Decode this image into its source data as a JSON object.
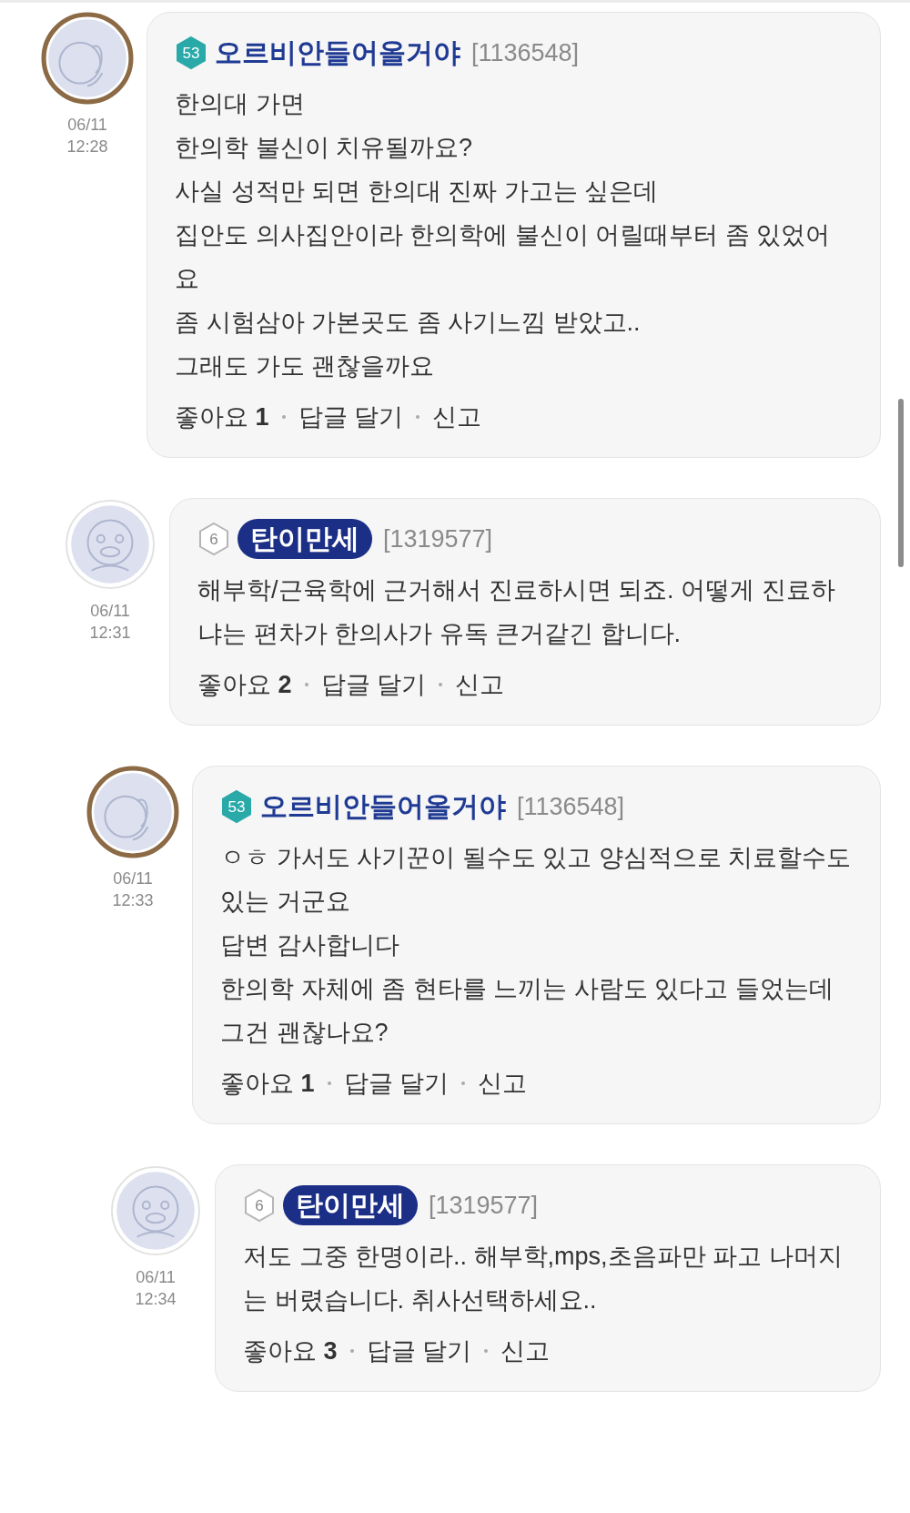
{
  "comments": [
    {
      "user": {
        "kind": "ring",
        "level": "53",
        "name": "오르비안들어올거야",
        "id": "[1136548]"
      },
      "date": "06/11",
      "time": "12:28",
      "lines": [
        "한의대 가면",
        "한의학 불신이 치유될까요?",
        "사실 성적만 되면 한의대 진짜 가고는 싶은데",
        "집안도 의사집안이라 한의학에 불신이 어릴때부터 좀 있었어요",
        "좀 시험삼아 가본곳도 좀 사기느낌 받았고..",
        "그래도 가도 괜찮을까요"
      ],
      "like_label": "좋아요",
      "likes": "1",
      "reply_label": "답글 달기",
      "report_label": "신고",
      "children": [
        {
          "user": {
            "kind": "pill",
            "level": "6",
            "name": "탄이만세",
            "id": "[1319577]"
          },
          "date": "06/11",
          "time": "12:31",
          "lines": [
            "해부학/근육학에 근거해서 진료하시면 되죠. 어떻게 진료하냐는 편차가 한의사가 유독 큰거같긴 합니다."
          ],
          "like_label": "좋아요",
          "likes": "2",
          "reply_label": "답글 달기",
          "report_label": "신고",
          "children": [
            {
              "user": {
                "kind": "ring",
                "level": "53",
                "name": "오르비안들어올거야",
                "id": "[1136548]"
              },
              "date": "06/11",
              "time": "12:33",
              "lines": [
                "ㅇㅎ 가서도 사기꾼이 될수도 있고 양심적으로 치료할수도 있는 거군요",
                "답변 감사합니다",
                "한의학 자체에 좀 현타를 느끼는 사람도 있다고 들었는데 그건 괜찮나요?"
              ],
              "like_label": "좋아요",
              "likes": "1",
              "reply_label": "답글 달기",
              "report_label": "신고",
              "children": [
                {
                  "user": {
                    "kind": "pill",
                    "level": "6",
                    "name": "탄이만세",
                    "id": "[1319577]"
                  },
                  "date": "06/11",
                  "time": "12:34",
                  "lines": [
                    "저도 그중 한명이라.. 해부학,mps,초음파만 파고 나머지는 버렸습니다. 취사선택하세요.."
                  ],
                  "like_label": "좋아요",
                  "likes": "3",
                  "reply_label": "답글 달기",
                  "report_label": "신고"
                }
              ]
            }
          ]
        }
      ]
    }
  ]
}
